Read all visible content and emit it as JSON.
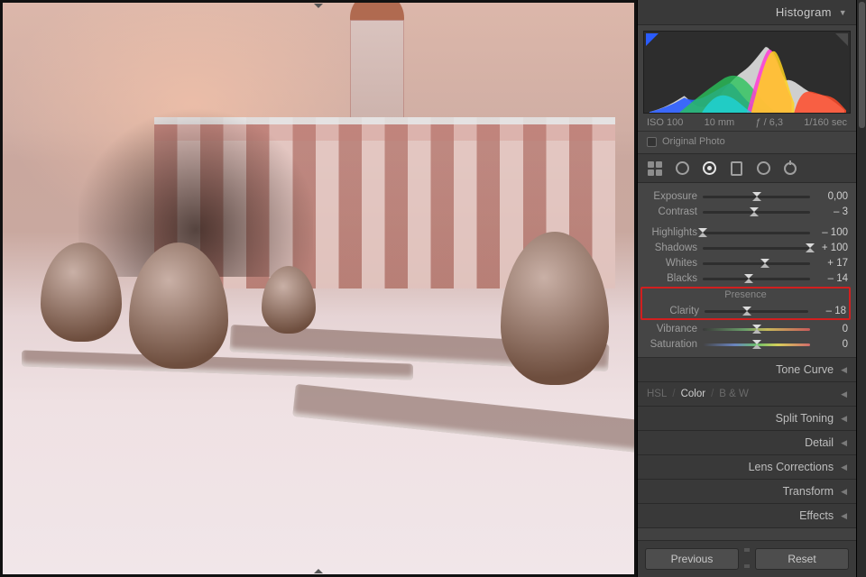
{
  "header": {
    "histogram_label": "Histogram"
  },
  "meta": {
    "iso": "ISO 100",
    "focal": "10 mm",
    "aperture": "ƒ / 6,3",
    "shutter": "1/160 sec"
  },
  "original_photo_label": "Original Photo",
  "sliders": {
    "exposure": {
      "label": "Exposure",
      "value": "0,00",
      "pos": 50
    },
    "contrast": {
      "label": "Contrast",
      "value": "– 3",
      "pos": 48
    },
    "highlights": {
      "label": "Highlights",
      "value": "– 100",
      "pos": 0
    },
    "shadows": {
      "label": "Shadows",
      "value": "+ 100",
      "pos": 100
    },
    "whites": {
      "label": "Whites",
      "value": "+ 17",
      "pos": 58
    },
    "blacks": {
      "label": "Blacks",
      "value": "– 14",
      "pos": 43
    },
    "presence_title": "Presence",
    "clarity": {
      "label": "Clarity",
      "value": "– 18",
      "pos": 41
    },
    "vibrance": {
      "label": "Vibrance",
      "value": "0",
      "pos": 50
    },
    "saturation": {
      "label": "Saturation",
      "value": "0",
      "pos": 50
    }
  },
  "closed_panels": {
    "tone_curve": "Tone Curve",
    "hsl_tabs": {
      "a": "HSL",
      "b": "Color",
      "c": "B & W"
    },
    "split_toning": "Split Toning",
    "detail": "Detail",
    "lens": "Lens Corrections",
    "transform": "Transform",
    "effects": "Effects"
  },
  "footer": {
    "previous": "Previous",
    "reset": "Reset"
  }
}
